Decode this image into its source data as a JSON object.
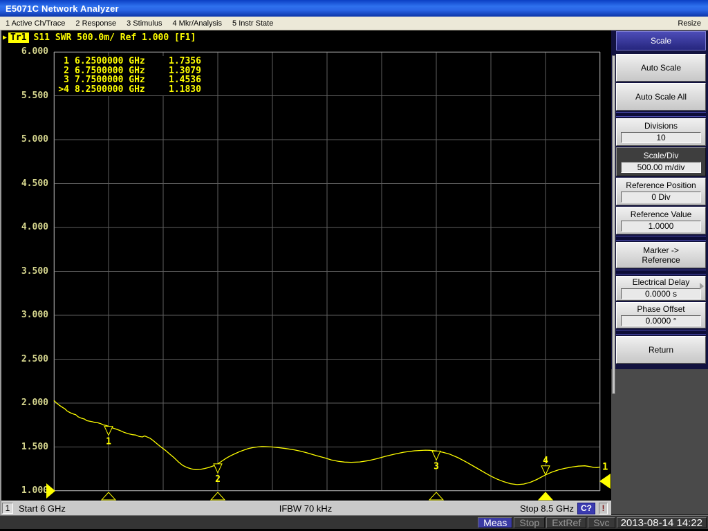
{
  "window": {
    "title": "E5071C Network Analyzer"
  },
  "menu": {
    "items": [
      "1 Active Ch/Trace",
      "2 Response",
      "3 Stimulus",
      "4 Mkr/Analysis",
      "5 Instr State"
    ],
    "resize": "Resize"
  },
  "trace_info": {
    "active_trace": "Tr1",
    "description": "S11 SWR 500.0m/ Ref 1.000 [F1]"
  },
  "markers": [
    {
      "prefix": "",
      "num": "1",
      "frequency": "6.2500000 GHz",
      "value": "1.7356",
      "ghz": 6.25,
      "swr": 1.7356,
      "number_position": "below",
      "stimulus_filled": false
    },
    {
      "prefix": "",
      "num": "2",
      "frequency": "6.7500000 GHz",
      "value": "1.3079",
      "ghz": 6.75,
      "swr": 1.3079,
      "number_position": "below",
      "stimulus_filled": false
    },
    {
      "prefix": "",
      "num": "3",
      "frequency": "7.7500000 GHz",
      "value": "1.4536",
      "ghz": 7.75,
      "swr": 1.4536,
      "number_position": "below",
      "stimulus_filled": false
    },
    {
      "prefix": ">",
      "num": "4",
      "frequency": "8.2500000 GHz",
      "value": "1.1830",
      "ghz": 8.25,
      "swr": 1.183,
      "number_position": "above",
      "stimulus_filled": true
    }
  ],
  "chart_data": {
    "type": "line",
    "trace_name": "Tr1 S11 SWR",
    "trace_number_label": "1",
    "xlim": [
      6.0,
      8.5
    ],
    "ylim": [
      1.0,
      6.0
    ],
    "x_unit": "GHz",
    "scale_per_div": 0.5,
    "x_divisions": 10,
    "y_divisions": 10,
    "yticks": [
      "6.000",
      "5.500",
      "5.000",
      "4.500",
      "4.000",
      "3.500",
      "3.000",
      "2.500",
      "2.000",
      "1.500",
      "1.000"
    ],
    "reference_value": 1.0,
    "points": [
      [
        6.0,
        2.03
      ],
      [
        6.01,
        2.005
      ],
      [
        6.025,
        1.975
      ],
      [
        6.04,
        1.95
      ],
      [
        6.05,
        1.935
      ],
      [
        6.06,
        1.91
      ],
      [
        6.075,
        1.89
      ],
      [
        6.09,
        1.875
      ],
      [
        6.1,
        1.868
      ],
      [
        6.11,
        1.845
      ],
      [
        6.125,
        1.828
      ],
      [
        6.14,
        1.818
      ],
      [
        6.15,
        1.8
      ],
      [
        6.16,
        1.795
      ],
      [
        6.175,
        1.788
      ],
      [
        6.19,
        1.777
      ],
      [
        6.2,
        1.776
      ],
      [
        6.215,
        1.765
      ],
      [
        6.225,
        1.752
      ],
      [
        6.24,
        1.745
      ],
      [
        6.25,
        1.736
      ],
      [
        6.265,
        1.72
      ],
      [
        6.28,
        1.708
      ],
      [
        6.3,
        1.69
      ],
      [
        6.32,
        1.668
      ],
      [
        6.34,
        1.652
      ],
      [
        6.36,
        1.64
      ],
      [
        6.375,
        1.636
      ],
      [
        6.39,
        1.62
      ],
      [
        6.405,
        1.614
      ],
      [
        6.415,
        1.626
      ],
      [
        6.425,
        1.616
      ],
      [
        6.44,
        1.6
      ],
      [
        6.455,
        1.572
      ],
      [
        6.47,
        1.54
      ],
      [
        6.49,
        1.5
      ],
      [
        6.51,
        1.462
      ],
      [
        6.53,
        1.42
      ],
      [
        6.55,
        1.378
      ],
      [
        6.57,
        1.33
      ],
      [
        6.59,
        1.29
      ],
      [
        6.61,
        1.265
      ],
      [
        6.63,
        1.25
      ],
      [
        6.65,
        1.242
      ],
      [
        6.67,
        1.245
      ],
      [
        6.69,
        1.255
      ],
      [
        6.71,
        1.268
      ],
      [
        6.73,
        1.285
      ],
      [
        6.75,
        1.308
      ],
      [
        6.77,
        1.342
      ],
      [
        6.79,
        1.375
      ],
      [
        6.81,
        1.402
      ],
      [
        6.83,
        1.425
      ],
      [
        6.85,
        1.447
      ],
      [
        6.87,
        1.465
      ],
      [
        6.89,
        1.482
      ],
      [
        6.91,
        1.493
      ],
      [
        6.93,
        1.5
      ],
      [
        6.95,
        1.505
      ],
      [
        6.97,
        1.504
      ],
      [
        7.0,
        1.5
      ],
      [
        7.03,
        1.492
      ],
      [
        7.06,
        1.483
      ],
      [
        7.1,
        1.468
      ],
      [
        7.13,
        1.452
      ],
      [
        7.16,
        1.432
      ],
      [
        7.2,
        1.402
      ],
      [
        7.24,
        1.376
      ],
      [
        7.27,
        1.352
      ],
      [
        7.3,
        1.338
      ],
      [
        7.33,
        1.328
      ],
      [
        7.36,
        1.325
      ],
      [
        7.4,
        1.33
      ],
      [
        7.44,
        1.345
      ],
      [
        7.48,
        1.368
      ],
      [
        7.52,
        1.395
      ],
      [
        7.56,
        1.42
      ],
      [
        7.6,
        1.44
      ],
      [
        7.65,
        1.457
      ],
      [
        7.7,
        1.464
      ],
      [
        7.72,
        1.462
      ],
      [
        7.75,
        1.454
      ],
      [
        7.78,
        1.44
      ],
      [
        7.81,
        1.42
      ],
      [
        7.85,
        1.378
      ],
      [
        7.89,
        1.325
      ],
      [
        7.93,
        1.268
      ],
      [
        7.97,
        1.21
      ],
      [
        8.0,
        1.168
      ],
      [
        8.03,
        1.132
      ],
      [
        8.06,
        1.104
      ],
      [
        8.09,
        1.082
      ],
      [
        8.12,
        1.072
      ],
      [
        8.15,
        1.078
      ],
      [
        8.18,
        1.098
      ],
      [
        8.21,
        1.13
      ],
      [
        8.25,
        1.183
      ],
      [
        8.28,
        1.215
      ],
      [
        8.31,
        1.24
      ],
      [
        8.34,
        1.258
      ],
      [
        8.37,
        1.272
      ],
      [
        8.4,
        1.282
      ],
      [
        8.43,
        1.286
      ],
      [
        8.45,
        1.278
      ],
      [
        8.47,
        1.268
      ],
      [
        8.485,
        1.266
      ],
      [
        8.5,
        1.272
      ]
    ]
  },
  "sidebar": {
    "title": "Scale",
    "buttons": [
      {
        "label": "Auto Scale"
      },
      {
        "label": "Auto Scale All"
      },
      {
        "label": "Divisions",
        "value": "10"
      },
      {
        "label": "Scale/Div",
        "value": "500.00 m/div",
        "selected": true
      },
      {
        "label": "Reference Position",
        "value": "0 Div"
      },
      {
        "label": "Reference Value",
        "value": "1.0000"
      },
      {
        "label": "Marker -> Reference"
      },
      {
        "label": "Electrical Delay",
        "value": "0.0000 s",
        "submenu": true
      },
      {
        "label": "Phase Offset",
        "value": "0.0000 °"
      },
      {
        "label": "Return"
      }
    ]
  },
  "channel_bar": {
    "channel": "1",
    "start": "Start 6 GHz",
    "ifbw": "IFBW 70 kHz",
    "stop": "Stop 8.5 GHz",
    "cal_badge": "C?",
    "warning": "!"
  },
  "taskbar": {
    "meas": "Meas",
    "stop": "Stop",
    "extref": "ExtRef",
    "svc": "Svc",
    "datetime": "2013-08-14 14:22"
  },
  "colors": {
    "trace": "#ffff00",
    "grid": "#5f5f5f",
    "grid_border": "#929292",
    "axis_label": "#d6d68e",
    "accent_blue": "#3b3bb0"
  }
}
